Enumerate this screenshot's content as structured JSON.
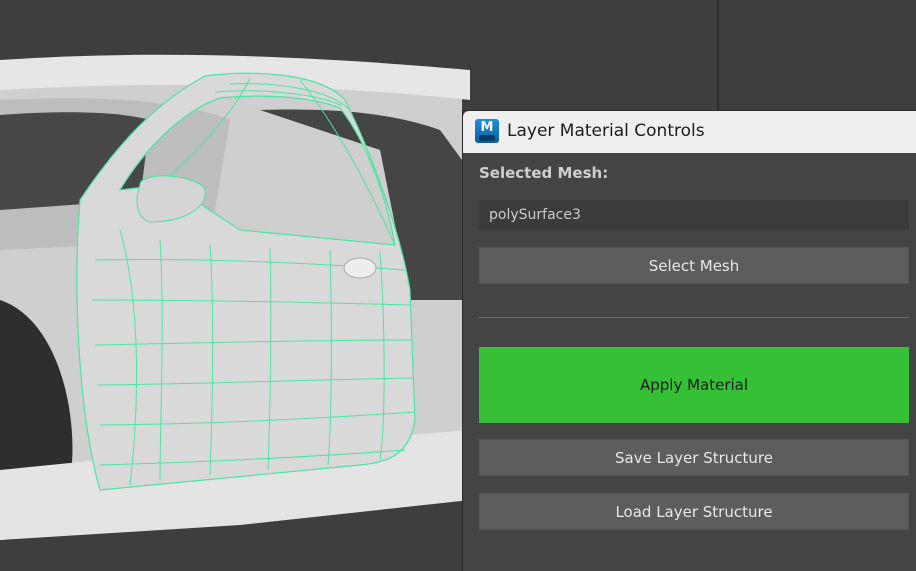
{
  "window": {
    "title": "Layer Material Controls",
    "icon": "maya-app-icon",
    "icon_letter": "M"
  },
  "panel": {
    "selected_mesh_label": "Selected Mesh:",
    "selected_mesh_value": "polySurface3",
    "select_mesh_button": "Select Mesh",
    "apply_material_button": "Apply Material",
    "save_layer_button": "Save Layer Structure",
    "load_layer_button": "Load Layer Structure"
  },
  "colors": {
    "apply_accent": "#36c036",
    "wireframe": "#4de3a0",
    "viewport_bg": "#3e3e3e",
    "panel_bg": "#444444"
  }
}
